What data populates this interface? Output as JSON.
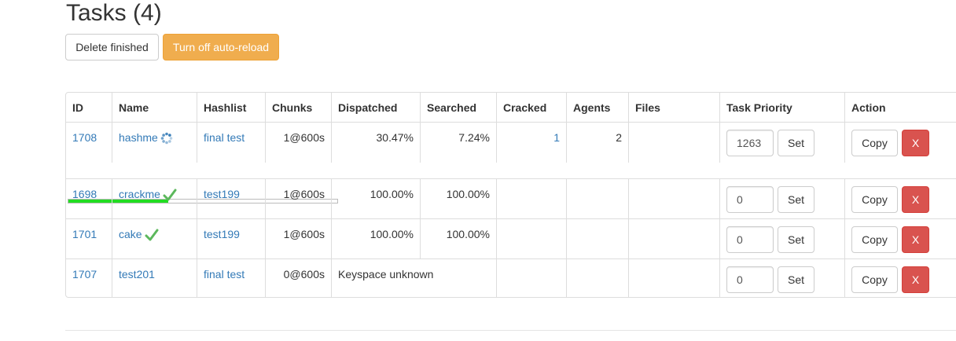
{
  "page": {
    "title": "Tasks (4)"
  },
  "toolbar": {
    "delete_label": "Delete finished",
    "reload_label": "Turn off auto-reload"
  },
  "table": {
    "headers": [
      "ID",
      "Name",
      "Hashlist",
      "Chunks",
      "Dispatched",
      "Searched",
      "Cracked",
      "Agents",
      "Files",
      "Task Priority",
      "Action"
    ],
    "set_label": "Set",
    "copy_label": "Copy",
    "delete_label": "X",
    "rows": [
      {
        "id": "1708",
        "name": "hashme",
        "status_icon": "spinner-icon",
        "hashlist": "final test",
        "chunks": "1@600s",
        "dispatched": "30.47%",
        "searched": "7.24%",
        "cracked": "1",
        "agents": "2",
        "files": "",
        "priority": "1263",
        "progress": 0.37
      },
      {
        "id": "1698",
        "name": "crackme",
        "status_icon": "check-icon",
        "hashlist": "test199",
        "chunks": "1@600s",
        "dispatched": "100.00%",
        "searched": "100.00%",
        "cracked": "",
        "agents": "",
        "files": "",
        "priority": "0"
      },
      {
        "id": "1701",
        "name": "cake",
        "status_icon": "check-icon",
        "hashlist": "test199",
        "chunks": "1@600s",
        "dispatched": "100.00%",
        "searched": "100.00%",
        "cracked": "",
        "agents": "",
        "files": "",
        "priority": "0"
      },
      {
        "id": "1707",
        "name": "test201",
        "status_icon": "",
        "hashlist": "final test",
        "chunks": "0@600s",
        "dispatched": "Keyspace unknown",
        "searched": "",
        "cracked": "",
        "agents": "",
        "files": "",
        "priority": "0"
      }
    ]
  },
  "colors": {
    "link": "#337ab7",
    "warning": "#f0ad4e",
    "danger": "#d9534f",
    "progress": "#22dd22",
    "check": "#5cb85c"
  }
}
